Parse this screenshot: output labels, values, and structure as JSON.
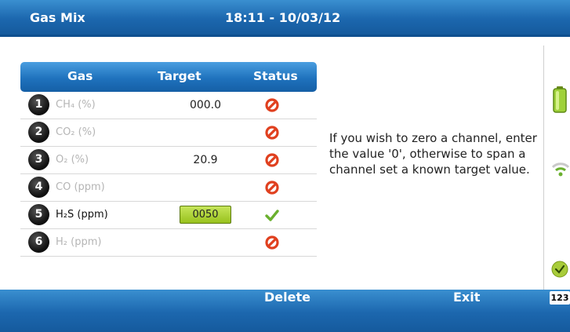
{
  "header": {
    "title": "Gas Mix",
    "datetime": "18:11 - 10/03/12"
  },
  "table": {
    "columns": [
      "Gas",
      "Target",
      "Status"
    ],
    "rows": [
      {
        "num": "1",
        "gas": "CH₄ (%)",
        "target": "000.0",
        "status": "error",
        "active": false,
        "editing": false
      },
      {
        "num": "2",
        "gas": "CO₂ (%)",
        "target": "",
        "status": "error",
        "active": false,
        "editing": false
      },
      {
        "num": "3",
        "gas": "O₂  (%)",
        "target": "20.9",
        "status": "error",
        "active": false,
        "editing": false
      },
      {
        "num": "4",
        "gas": "CO  (ppm)",
        "target": "",
        "status": "error",
        "active": false,
        "editing": false
      },
      {
        "num": "5",
        "gas": "H₂S (ppm)",
        "target": "0050",
        "status": "ok",
        "active": true,
        "editing": true
      },
      {
        "num": "6",
        "gas": "H₂  (ppm)",
        "target": "",
        "status": "error",
        "active": false,
        "editing": false
      }
    ]
  },
  "info": "If you wish to zero a channel, enter the value '0', otherwise to span a channel set a known target value.",
  "side_icons": [
    "battery-icon",
    "signal-icon",
    "ok-icon"
  ],
  "footer": {
    "delete_label": "Delete",
    "exit_label": "Exit",
    "keyboard_mode": "123"
  },
  "colors": {
    "accent": "#1c67ae",
    "error": "#e0401f",
    "ok": "#6ab02e",
    "edit": "#a8d034"
  }
}
